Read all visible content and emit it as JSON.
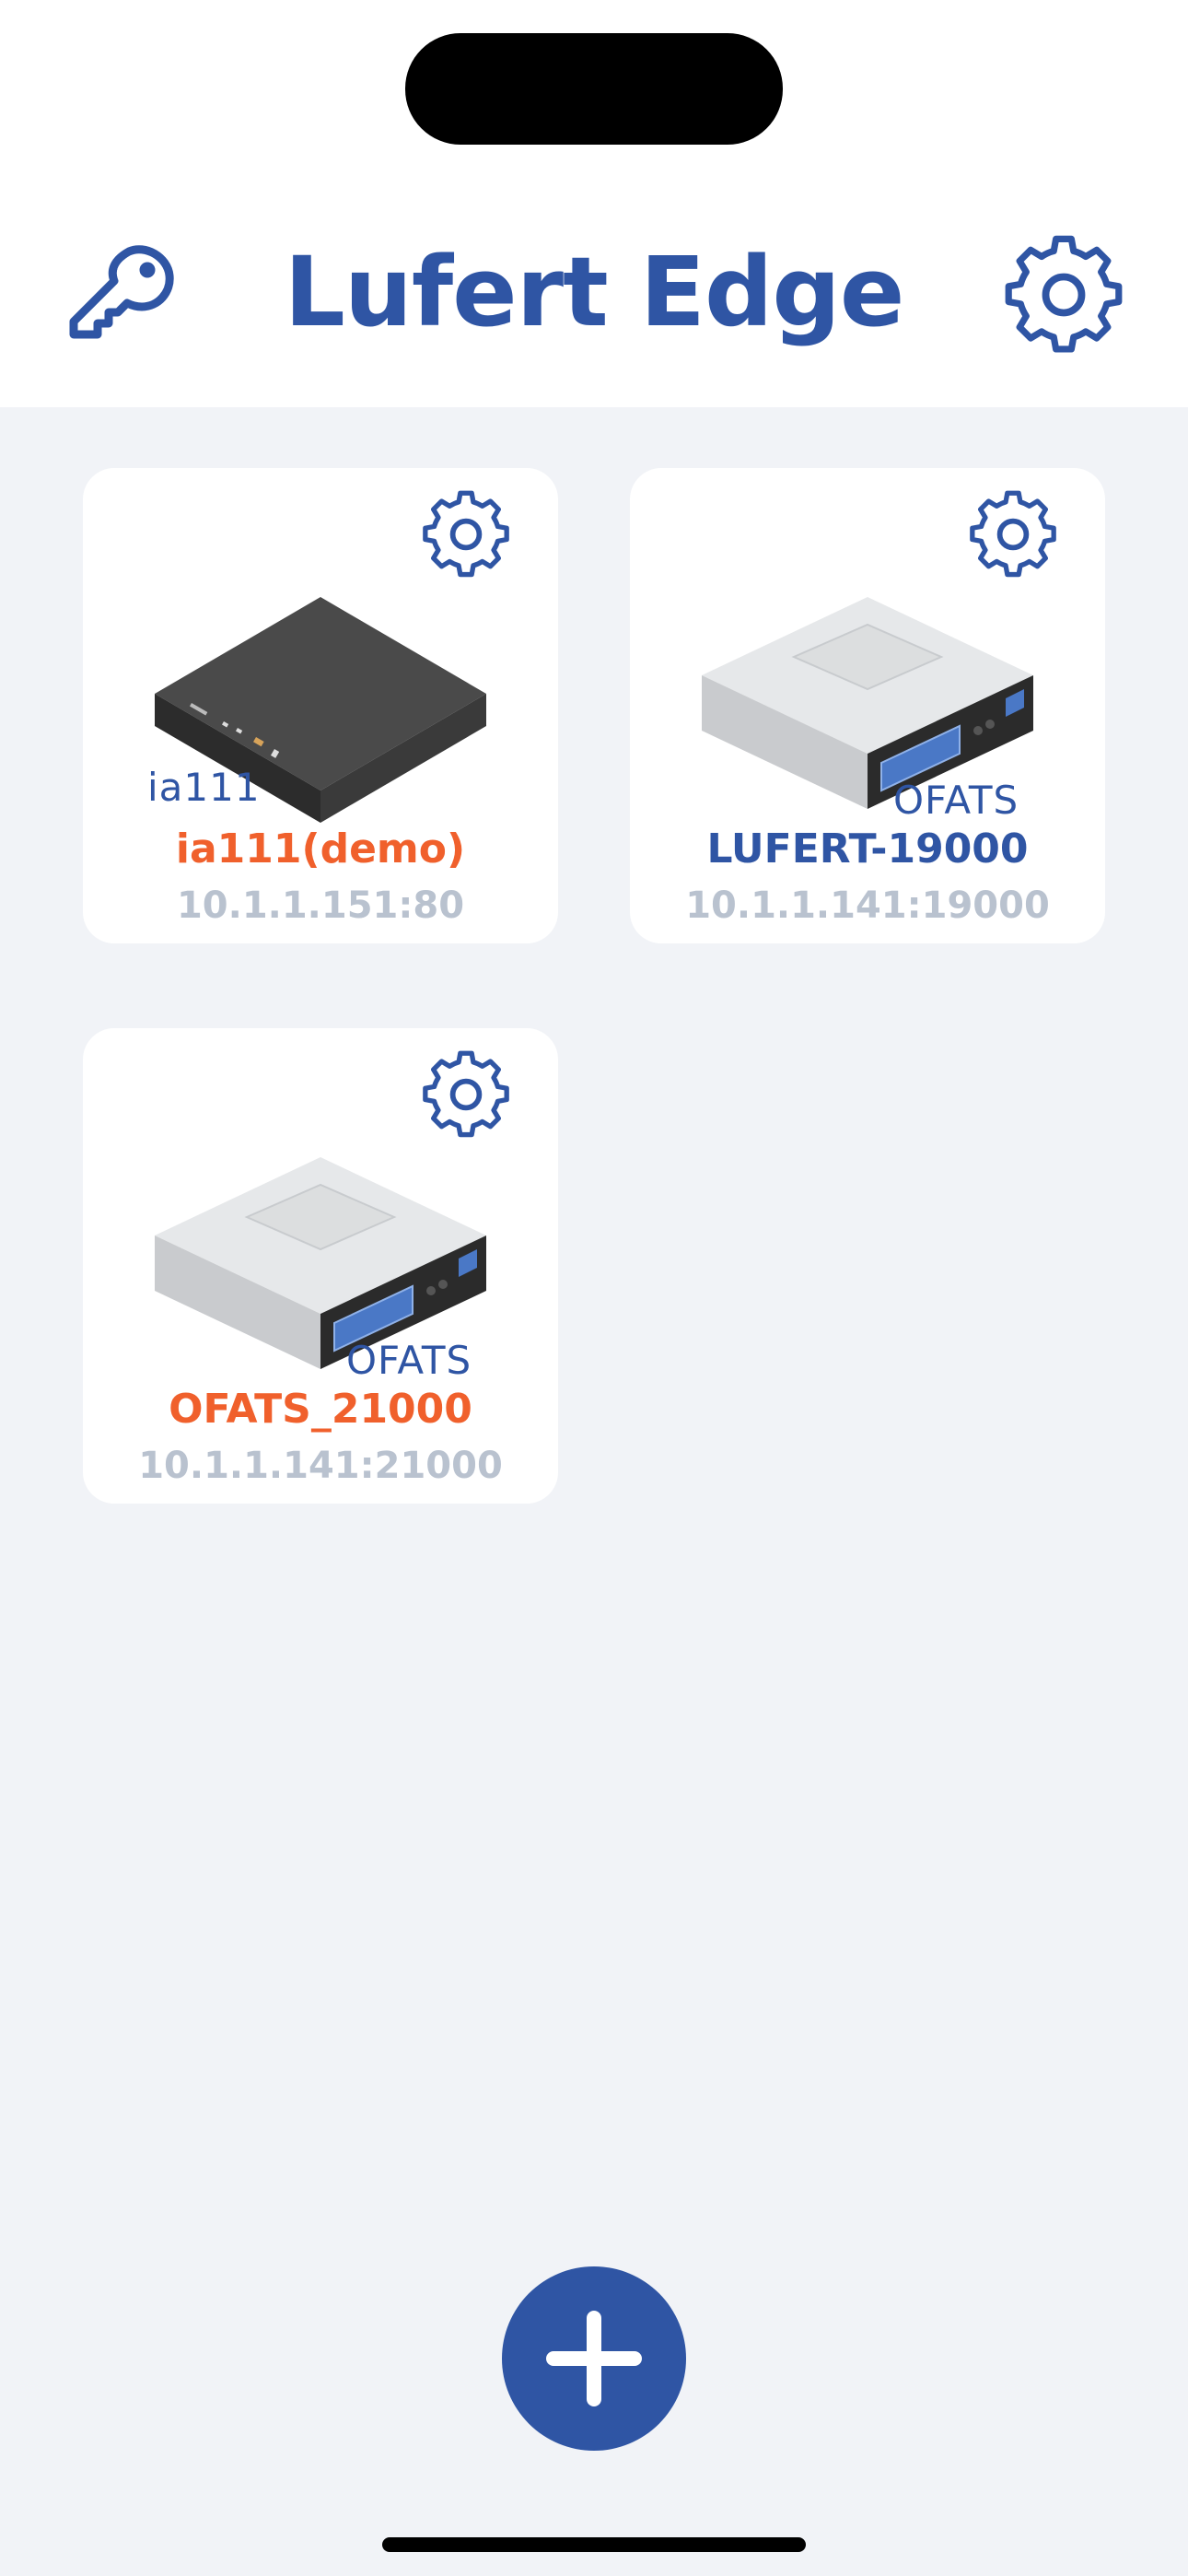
{
  "app": {
    "title": "Lufert Edge"
  },
  "colors": {
    "accent": "#2f55a4",
    "warning_name": "#f0602c",
    "address": "#b9c2cf",
    "background": "#f1f3f7"
  },
  "header": {
    "left_icon": "key-icon",
    "right_icon": "gear-icon"
  },
  "devices": [
    {
      "model_label": "ia111",
      "name": "ia111(demo)",
      "address": "10.1.1.151:80",
      "name_color": "orange",
      "image": "flat-black-router"
    },
    {
      "model_label": "OFATS",
      "name": "LUFERT-19000",
      "address": "10.1.1.141:19000",
      "name_color": "blue",
      "image": "rack-server"
    },
    {
      "model_label": "OFATS",
      "name": "OFATS_21000",
      "address": "10.1.1.141:21000",
      "name_color": "orange",
      "image": "rack-server"
    }
  ],
  "fab": {
    "icon": "plus-icon"
  }
}
